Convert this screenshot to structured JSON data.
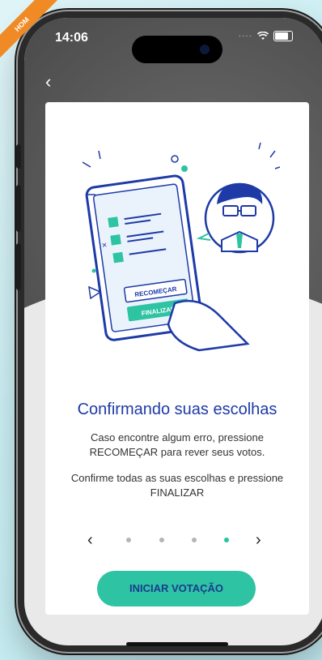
{
  "status": {
    "time": "14:06",
    "badge": "HOM"
  },
  "nav": {
    "back_glyph": "‹"
  },
  "illustration": {
    "button_restart": "RECOMEÇAR",
    "button_finish": "FINALIZAR"
  },
  "content": {
    "title": "Confirmando suas escolhas",
    "paragraph1": "Caso encontre algum erro, pressione RECOMEÇAR para rever seus votos.",
    "paragraph2": "Confirme todas as suas escolhas e pressione FINALIZAR"
  },
  "pager": {
    "prev_glyph": "‹",
    "next_glyph": "›",
    "pages": 4,
    "current": 4
  },
  "cta": {
    "label": "INICIAR VOTAÇÃO"
  },
  "colors": {
    "accent": "#2ec3a3",
    "title_blue": "#1e3aa7",
    "badge_orange": "#f08a24"
  }
}
